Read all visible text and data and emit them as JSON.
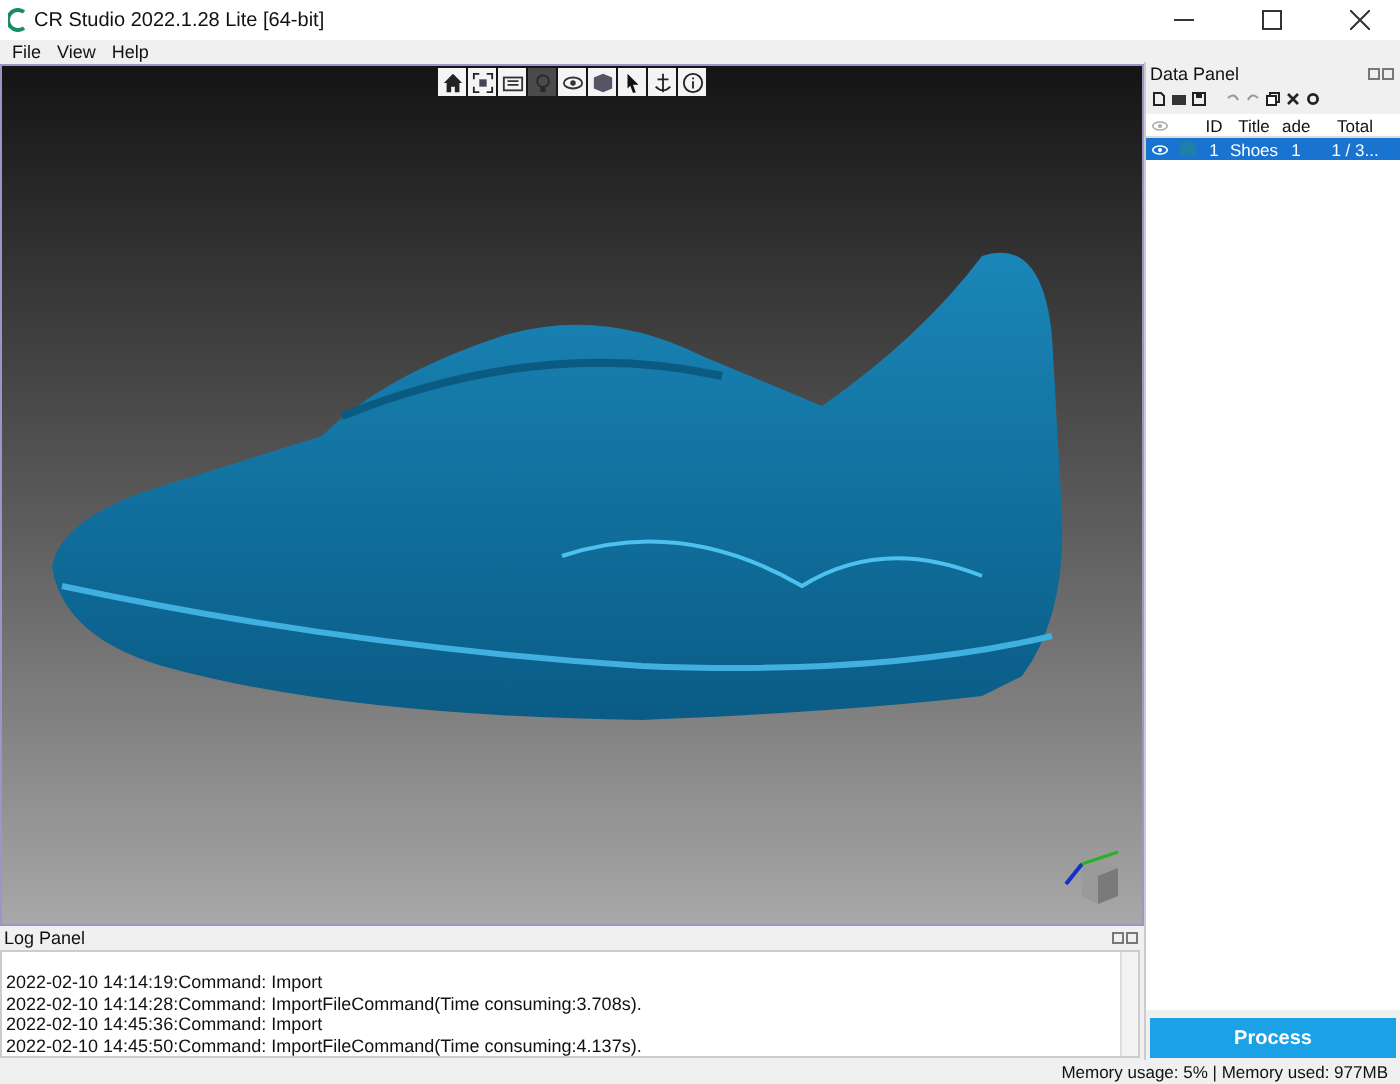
{
  "window": {
    "title": "CR Studio 2022.1.28 Lite [64-bit]"
  },
  "menu": [
    "File",
    "View",
    "Help"
  ],
  "viewport_toolbar": [
    {
      "kind": "home",
      "selected": false
    },
    {
      "kind": "fit",
      "selected": false
    },
    {
      "kind": "render",
      "selected": false
    },
    {
      "kind": "light",
      "selected": true
    },
    {
      "kind": "eye",
      "selected": false
    },
    {
      "kind": "box",
      "selected": false
    },
    {
      "kind": "pointer",
      "selected": false
    },
    {
      "kind": "anchor",
      "selected": false
    },
    {
      "kind": "info",
      "selected": false
    }
  ],
  "data_panel": {
    "title": "Data Panel",
    "columns": [
      "ID",
      "Title",
      "ade",
      "Total"
    ],
    "rows": [
      {
        "id": "1",
        "title": "Shoes",
        "shade": "1",
        "total": "1 / 3...",
        "selected": true,
        "color": "#1e7fa8"
      }
    ]
  },
  "log_panel": {
    "title": "Log Panel",
    "lines": [
      "2022-02-10 14:14:19:Command: Import",
      "2022-02-10 14:14:28:Command: ImportFileCommand(Time consuming:3.708s).",
      "2022-02-10 14:45:36:Command: Import",
      "2022-02-10 14:45:50:Command: ImportFileCommand(Time consuming:4.137s)."
    ]
  },
  "process_button": "Process",
  "status_bar": "Memory usage: 5% | Memory used: 977MB"
}
